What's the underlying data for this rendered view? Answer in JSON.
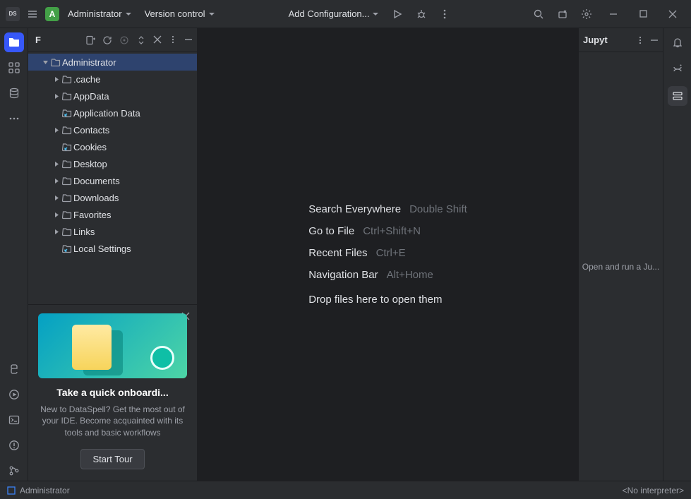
{
  "titlebar": {
    "app_initials": "DS",
    "project_initial": "A",
    "project_name": "Administrator",
    "vcs_label": "Version control",
    "config_label": "Add Configuration..."
  },
  "project_panel": {
    "header_letter": "F",
    "tree": [
      {
        "label": "Administrator",
        "indent": 0,
        "expanded": true,
        "has_children": true,
        "selected": true,
        "shortcut": false
      },
      {
        "label": ".cache",
        "indent": 1,
        "expanded": false,
        "has_children": true,
        "shortcut": false
      },
      {
        "label": "AppData",
        "indent": 1,
        "expanded": false,
        "has_children": true,
        "shortcut": false
      },
      {
        "label": "Application Data",
        "indent": 1,
        "expanded": false,
        "has_children": false,
        "shortcut": true
      },
      {
        "label": "Contacts",
        "indent": 1,
        "expanded": false,
        "has_children": true,
        "shortcut": false
      },
      {
        "label": "Cookies",
        "indent": 1,
        "expanded": false,
        "has_children": false,
        "shortcut": true
      },
      {
        "label": "Desktop",
        "indent": 1,
        "expanded": false,
        "has_children": true,
        "shortcut": false
      },
      {
        "label": "Documents",
        "indent": 1,
        "expanded": false,
        "has_children": true,
        "shortcut": false
      },
      {
        "label": "Downloads",
        "indent": 1,
        "expanded": false,
        "has_children": true,
        "shortcut": false
      },
      {
        "label": "Favorites",
        "indent": 1,
        "expanded": false,
        "has_children": true,
        "shortcut": false
      },
      {
        "label": "Links",
        "indent": 1,
        "expanded": false,
        "has_children": true,
        "shortcut": false
      },
      {
        "label": "Local Settings",
        "indent": 1,
        "expanded": false,
        "has_children": false,
        "shortcut": true
      }
    ]
  },
  "onboarding": {
    "title": "Take a quick onboardi...",
    "desc": "New to DataSpell? Get the most out of your IDE. Become acquainted with its tools and basic workflows",
    "button": "Start Tour"
  },
  "editor_hints": [
    {
      "label": "Search Everywhere",
      "shortcut": "Double Shift"
    },
    {
      "label": "Go to File",
      "shortcut": "Ctrl+Shift+N"
    },
    {
      "label": "Recent Files",
      "shortcut": "Ctrl+E"
    },
    {
      "label": "Navigation Bar",
      "shortcut": "Alt+Home"
    }
  ],
  "editor_drop": "Drop files here to open them",
  "right_panel": {
    "title": "Jupyt",
    "body": "Open and run a Ju..."
  },
  "statusbar": {
    "project": "Administrator",
    "interpreter": "<No interpreter>"
  }
}
